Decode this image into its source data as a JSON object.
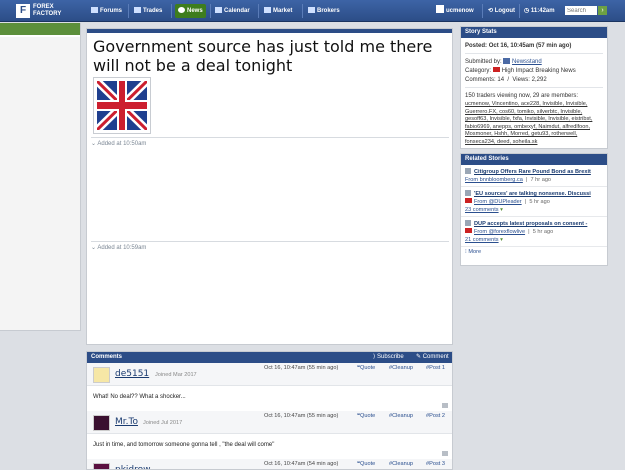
{
  "nav": {
    "logo_line1": "FOREX",
    "logo_line2": "FACTORY",
    "items": [
      {
        "label": "Forums"
      },
      {
        "label": "Trades"
      },
      {
        "label": "News"
      },
      {
        "label": "Calendar"
      },
      {
        "label": "Market"
      },
      {
        "label": "Brokers"
      }
    ],
    "username": "ucmenow",
    "logout": "Logout",
    "time": "11:42am",
    "search_placeholder": "Search",
    "accent_color": "#3e7d1e"
  },
  "story": {
    "title": "Government source has just told me there will not be a deal tonight",
    "added1": "Added at 10:50am",
    "added2": "Added at 10:59am"
  },
  "stats": {
    "header": "Story Stats",
    "posted_label": "Posted:",
    "posted_value": "Oct 16, 10:45am (57 min ago)",
    "submitted_label": "Submitted by:",
    "submitted_by": "Newsstand",
    "category_label": "Category:",
    "category_value": "High Impact Breaking News",
    "comments_label": "Comments:",
    "comments_value": "14",
    "views_label": "Views:",
    "views_value": "2,292",
    "viewing_text": "150 traders viewing now, 29 are members:",
    "members": "ucmenow, Vincentino, ace228, Invisible, Invisible, Guerrero.FX, cos60, tomiko, silverbtc, Invisible, gesoff63, Invisible, fxfa, Invisible, Invisible, eistribst, fabio6969, anepps, ombexyf, Naimdut, alfredlfoon, Mosmoner, Hshh, Morred, getu93, rotherwell, fonseca234, deed, soheila.sk"
  },
  "related": {
    "header": "Related Stories",
    "items": [
      {
        "title": "Citigroup Offers Rare Pound Bond as Brexit",
        "source": "From bnnbloomberg.ca",
        "time": "7 hr ago",
        "comments": ""
      },
      {
        "title": "'EU sources' are talking nonsense. Discussi",
        "source": "From @DUPleader",
        "time": "5 hr ago",
        "comments": "23 comments"
      },
      {
        "title": "DUP accepts latest proposals on consent -",
        "source": "From @forexflowlive",
        "time": "5 hr ago",
        "comments": "21 comments"
      }
    ],
    "more": "More"
  },
  "comments": {
    "header": "Comments",
    "subscribe": "Subscribe",
    "comment": "Comment",
    "quote_label": "Quote",
    "cleanup_label": "Cleanup",
    "list": [
      {
        "user": "de5151",
        "joined": "Joined Mar 2017",
        "time": "Oct 16, 10:47am (55 min ago)",
        "post": "Post 1",
        "body": "What! No deal?? What a shocker..."
      },
      {
        "user": "Mr.To",
        "joined": "Joined Jul 2017",
        "time": "Oct 16, 10:47am (55 min ago)",
        "post": "Post 2",
        "body": "Just in time, and tomorrow someone gonna tell , \"the deal will come\""
      },
      {
        "user": "pkidrow",
        "joined": "",
        "time": "Oct 16, 10:47am (54 min ago)",
        "post": "Post 3",
        "body": ""
      }
    ]
  }
}
